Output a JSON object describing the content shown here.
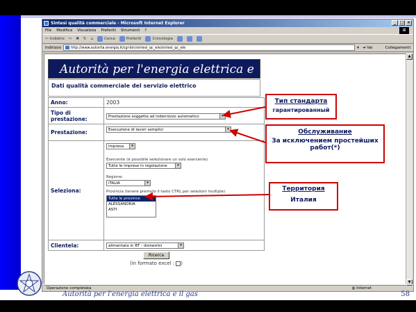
{
  "browser": {
    "title": "Sintesi qualità commerciale - Microsoft Internet Explorer",
    "menu": [
      "File",
      "Modifica",
      "Visualizza",
      "Preferiti",
      "Strumenti",
      "?"
    ],
    "toolbar": {
      "back": "Indietro",
      "search": "Cerca",
      "favorites": "Preferiti",
      "history": "Cronologia"
    },
    "address_label": "Indirizzo",
    "url": "http://www.autorita.energia.it/cgi-bin/sintesi_qc_ele/sintesi_qc_ele",
    "go": "Vai",
    "links": "Collegamenti",
    "status": "Operazione completata",
    "zone": "Internet"
  },
  "page": {
    "header": "Autorità per l'energia elettrica e il gas",
    "subtitle": "Dati qualità commerciale del servizio elettrico",
    "anno_label": "Anno:",
    "anno_value": "2003",
    "tipo_label": "Tipo di prestazione:",
    "tipo_value": "Prestazione soggetta ad indennizzo automatico",
    "prestazione_label": "Prestazione:",
    "prestazione_value": "Esecuzione di lavori semplici",
    "seleziona_label": "Seleziona:",
    "impresa_value": "Impresa",
    "esercente_label": "Esercente",
    "esercente_note": "(è possibile selezionare un solo esercente)",
    "esercente_value": "Tutte le imprese in regolazione",
    "regione_label": "Regione:",
    "regione_value": "ITALIA",
    "provincia_label": "Provincia",
    "provincia_note": "(tenere premuto il tasto CTRL per selezioni multiple)",
    "provincia_options": [
      "Tutte le province",
      "ALESSANDRIA",
      "ASTI"
    ],
    "clientela_label": "Clientela:",
    "clientela_value": "alimentata in BT - domestici",
    "ricerca_button": "Ricerca",
    "excel_label": "(in formato excel :",
    "excel_close": ")"
  },
  "annotations": [
    {
      "title": "Тип стандарта",
      "desc": "гарантированный"
    },
    {
      "title": "Обслуживание",
      "desc": "За исключением простейших работ(*)"
    },
    {
      "title": "Территория",
      "desc": "Италия"
    }
  ],
  "footer": {
    "text": "Autorità per l'energia elettrica e il gas",
    "page_number": "58"
  }
}
